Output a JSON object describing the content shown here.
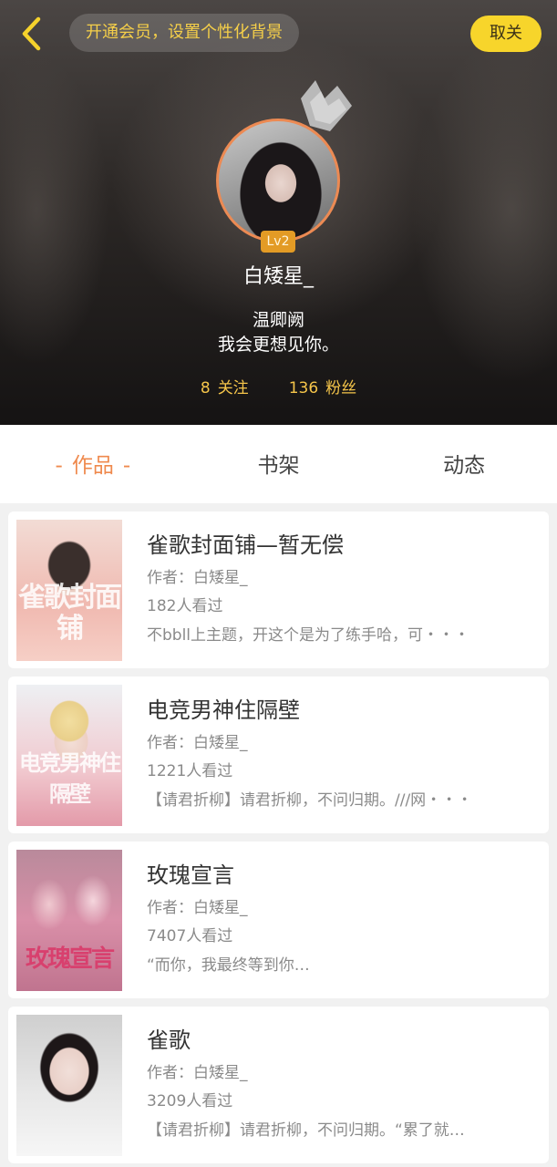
{
  "header": {
    "vip_prompt": "开通会员，设置个性化背景",
    "unfollow_label": "取关",
    "level_badge": "Lv2",
    "username": "白矮星_",
    "bio_line1": "温卿阙",
    "bio_line2": "我会更想见你。",
    "following_count": "8",
    "following_label": "关注",
    "fans_count": "136",
    "fans_label": "粉丝"
  },
  "tabs": [
    {
      "label": "作品",
      "active": true
    },
    {
      "label": "书架",
      "active": false
    },
    {
      "label": "动态",
      "active": false
    }
  ],
  "active_tab_dash": "-",
  "works": [
    {
      "title": "雀歌封面铺—暂无偿",
      "author": "作者：白矮星_",
      "views": "182人看过",
      "description": "不bbll上主题，开这个是为了练手哈，可・・・",
      "cover_text": "雀歌封面铺"
    },
    {
      "title": "电竞男神住隔壁",
      "author": "作者：白矮星_",
      "views": "1221人看过",
      "description": "【请君折柳】请君折柳，不问归期。///网・・・",
      "cover_text": "电竞男神住隔壁"
    },
    {
      "title": "玫瑰宣言",
      "author": "作者：白矮星_",
      "views": "7407人看过",
      "description": "“而你，我最终等到你…",
      "cover_text": "玫瑰宣言"
    },
    {
      "title": "雀歌",
      "author": "作者：白矮星_",
      "views": "3209人看过",
      "description": "【请君折柳】请君折柳，不问归期。“累了就…",
      "cover_text": ""
    }
  ],
  "colors": {
    "accent_orange": "#ef8a4e",
    "unfollow_yellow": "#f7d52b",
    "stats_gold": "#f5c54a",
    "level_badge": "#e39b25"
  },
  "icons": [
    "back-arrow-icon",
    "crown-icon"
  ]
}
